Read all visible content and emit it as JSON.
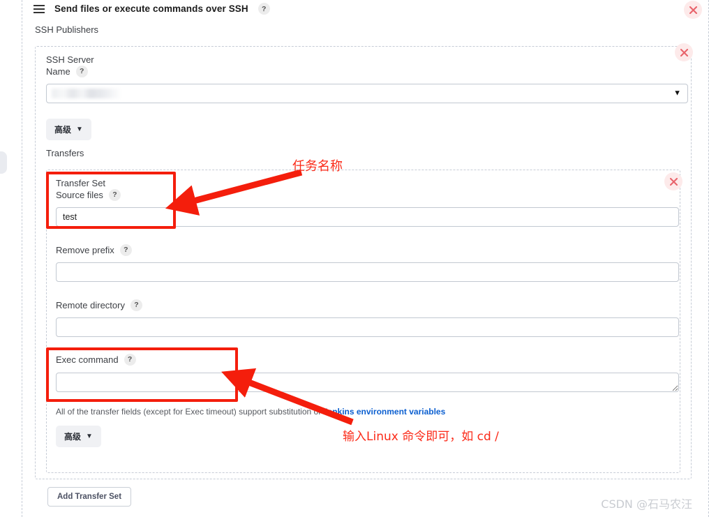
{
  "header": {
    "menu_icon": "hamburger-icon",
    "title": "Send files or execute commands over SSH",
    "help": "?"
  },
  "section": {
    "publishers_label": "SSH Publishers"
  },
  "ssh_server": {
    "label_line1": "SSH Server",
    "label_line2": "Name",
    "help": "?",
    "selected_value": "",
    "caret": "⌄",
    "advanced_label": "高级",
    "advanced_caret": "⌄"
  },
  "transfers": {
    "label": "Transfers",
    "transfer_set": {
      "label_line1": "Transfer Set",
      "label_line2": "Source files",
      "help": "?",
      "source_files_value": "test",
      "source_files_placeholder": ""
    },
    "remove_prefix": {
      "label": "Remove prefix",
      "help": "?",
      "value": "",
      "placeholder": ""
    },
    "remote_directory": {
      "label": "Remote directory",
      "help": "?",
      "value": "",
      "placeholder": ""
    },
    "exec_command": {
      "label": "Exec command",
      "help": "?",
      "value": "",
      "placeholder": ""
    },
    "note_text": "All of the transfer fields (except for Exec timeout) support substitution of ",
    "note_link": "Jenkins environment variables",
    "advanced_label": "高级",
    "advanced_caret": "⌄"
  },
  "buttons": {
    "add_transfer_set": "Add Transfer Set",
    "close_icon": "close-x-icon"
  },
  "annotations": {
    "task_name": "任务名称",
    "exec_hint": "输入Linux 命令即可，如 cd /",
    "color": "#f41e0c"
  },
  "watermark": "CSDN @石马农汪"
}
